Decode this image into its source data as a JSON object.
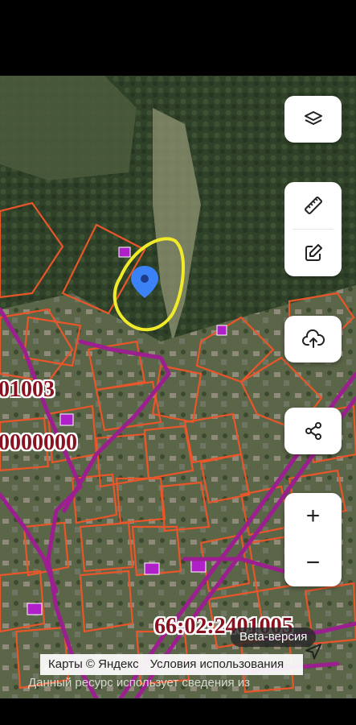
{
  "map": {
    "cadastral_labels": [
      "01003",
      "0000000",
      "66:02:2401005"
    ],
    "parcel_color": "#e8562a",
    "road_color": "#9b1f8f",
    "outline_color": "#f0ea2a",
    "pin_color": "#3b82f6"
  },
  "controls": {
    "layers_icon": "layers-icon",
    "ruler_icon": "ruler-icon",
    "edit_icon": "edit-icon",
    "upload_icon": "cloud-upload-icon",
    "share_icon": "share-icon",
    "zoom_in_label": "+",
    "zoom_out_label": "−"
  },
  "badge": {
    "beta": "Beta-версия"
  },
  "attribution": {
    "copyright": "Карты © Яндекс",
    "terms": "Условия использования"
  },
  "notice": "Данный ресурс использует сведения из"
}
